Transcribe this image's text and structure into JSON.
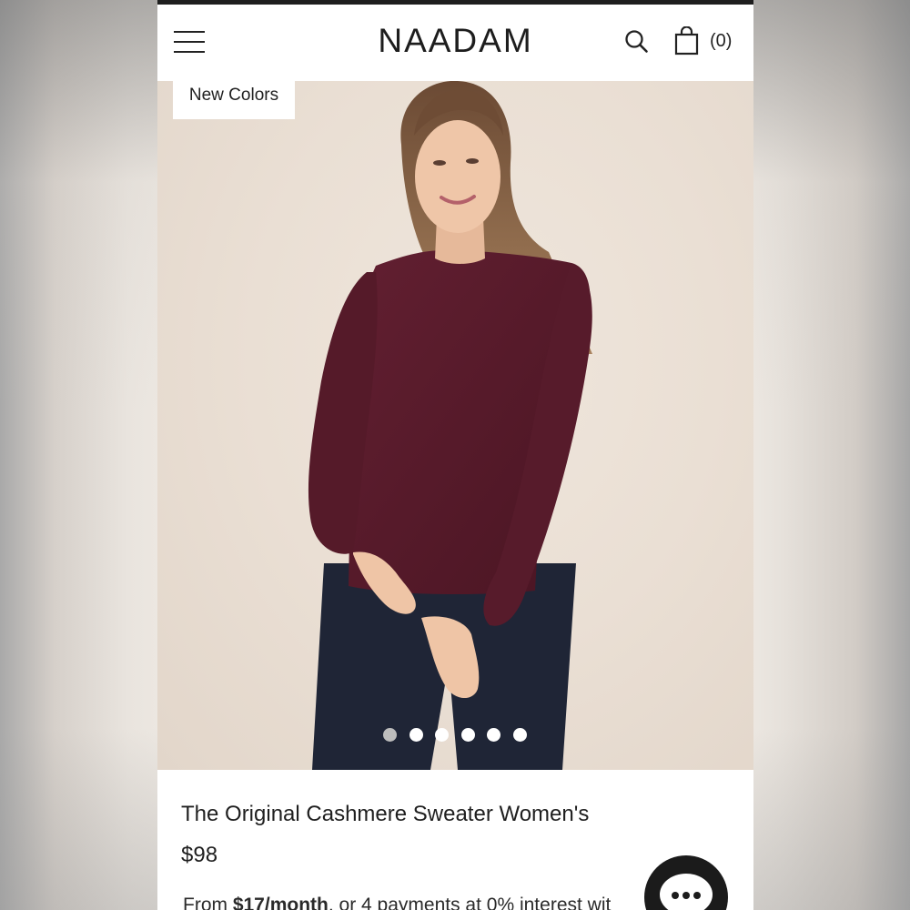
{
  "header": {
    "logo": "NAADAM",
    "cart_count": "(0)",
    "icons": [
      "menu-icon",
      "search-icon",
      "shopping-bag-icon"
    ]
  },
  "hero": {
    "badge": "New Colors",
    "carousel": {
      "total": 6,
      "active": 1
    },
    "colors": {
      "sweater": "#5a1c2b",
      "denim": "#1f2536",
      "background": "#ece4da"
    }
  },
  "product": {
    "title": "The Original Cashmere Sweater Women's",
    "price": "$98",
    "installment_prefix": "From ",
    "installment_amount": "$17/month",
    "installment_suffix": ", or 4 payments at 0% interest wit"
  },
  "chat": {
    "icon": "chat-bubble-icon"
  }
}
